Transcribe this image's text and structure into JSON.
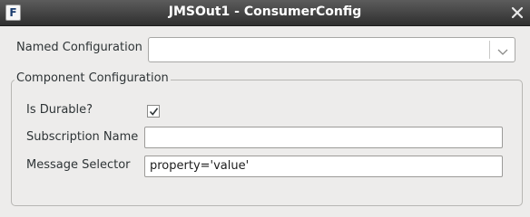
{
  "window": {
    "title": "JMSOut1 - ConsumerConfig",
    "app_icon_glyph": "F"
  },
  "named_configuration": {
    "label": "Named Configuration",
    "value": ""
  },
  "component_configuration": {
    "group_label": "Component Configuration",
    "is_durable": {
      "label": "Is Durable?",
      "checked": true
    },
    "subscription_name": {
      "label": "Subscription Name",
      "value": ""
    },
    "message_selector": {
      "label": "Message Selector",
      "value": "property='value'"
    }
  },
  "icons": {
    "app": "app-window-icon",
    "close": "close-icon",
    "dropdown": "chevron-down-icon",
    "check": "checkmark-icon"
  }
}
